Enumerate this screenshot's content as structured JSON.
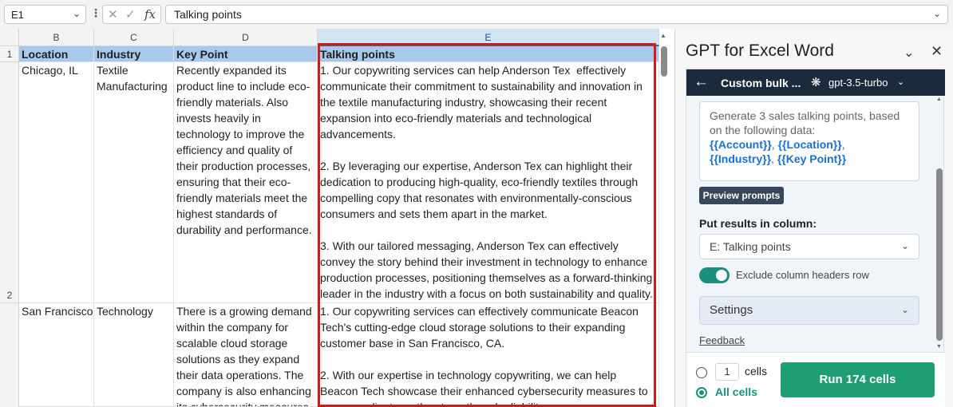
{
  "formula_bar": {
    "name_box": "E1",
    "more": "⋮",
    "cancel_icon": "✕",
    "enter_icon": "✓",
    "function_icon": "fx",
    "value": "Talking points"
  },
  "grid": {
    "columns": [
      "B",
      "C",
      "D",
      "E"
    ],
    "rows": [
      "1",
      "2"
    ],
    "headers": {
      "location": "Location",
      "industry": "Industry",
      "key_point": "Key Point",
      "talking_points": "Talking points"
    },
    "row1": {
      "location": "Chicago, IL",
      "industry": "Textile Manufacturing",
      "key_point": "Recently expanded its product line to include eco-friendly materials. Also invests heavily in technology to improve the efficiency and quality of their production processes, ensuring that their eco-friendly materials meet the highest standards of durability and performance.",
      "talking_points": "1. Our copywriting services can help Anderson Tex  effectively communicate their commitment to sustainability and innovation in the textile manufacturing industry, showcasing their recent expansion into eco-friendly materials and technological advancements.\n\n2. By leveraging our expertise, Anderson Tex can highlight their dedication to producing high-quality, eco-friendly textiles through compelling copy that resonates with environmentally-conscious consumers and sets them apart in the market.\n\n3. With our tailored messaging, Anderson Tex can effectively convey the story behind their investment in technology to enhance production processes, positioning themselves as a forward-thinking leader in the industry with a focus on both sustainability and quality."
    },
    "row2": {
      "location": "San Francisco,",
      "industry": "Technology",
      "key_point": "There is a growing demand within the company for scalable cloud storage solutions as they expand their data operations. The company is also enhancing its cybersecurity measures",
      "talking_points": "1. Our copywriting services can effectively communicate Beacon Tech's cutting-edge cloud storage solutions to their expanding customer base in San Francisco, CA.\n\n2. With our expertise in technology copywriting, we can help Beacon Tech showcase their enhanced cybersecurity measures to reassure clients on the strength and reliability"
    }
  },
  "panel": {
    "title": "GPT for Excel Word",
    "collapse_icon": "chevron-down",
    "close_icon": "close",
    "card_title": "Custom bulk ...",
    "model": "gpt-3.5-turbo",
    "prompt_text": "Generate 3 sales talking points, based on the following data:",
    "prompt_vars": [
      "{{Account}}",
      "{{Location}}",
      "{{Industry}}",
      "{{Key Point}}"
    ],
    "preview_button": "Preview prompts",
    "put_results_label": "Put results in column:",
    "column_select": "E: Talking points",
    "exclude_headers_label": "Exclude column headers row",
    "exclude_headers_on": true,
    "settings_label": "Settings",
    "feedback_link": "Feedback",
    "cells_count": "1",
    "cells_label": "cells",
    "all_cells_label": "All cells",
    "run_button": "Run 174 cells"
  },
  "colors": {
    "header_fill": "#a9c9ec",
    "selection_outline": "#d11a1a",
    "panel_header": "#1b2a3d",
    "accent_green": "#1f9e76",
    "link_blue": "#1a6fd1"
  }
}
